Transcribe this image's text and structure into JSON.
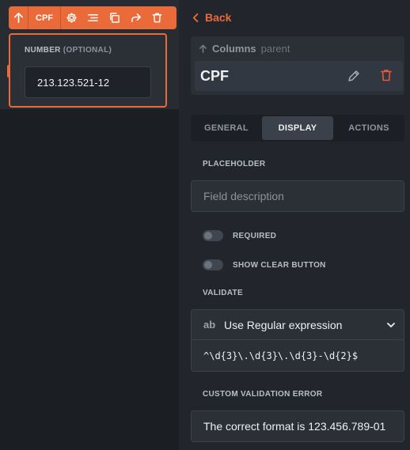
{
  "canvas": {
    "toolbar": {
      "label": "CPF",
      "icons": [
        "arrow-up-icon",
        "gear-icon",
        "align-icon",
        "copy-icon",
        "share-icon",
        "trash-icon"
      ]
    },
    "field": {
      "label": "NUMBER",
      "label_suffix": "(OPTIONAL)",
      "value": "213.123.521-12"
    }
  },
  "panel": {
    "back_label": "Back",
    "parent": {
      "name": "Columns",
      "suffix": "parent"
    },
    "element_title": "CPF",
    "tabs": [
      {
        "label": "GENERAL",
        "active": false
      },
      {
        "label": "DISPLAY",
        "active": true
      },
      {
        "label": "ACTIONS",
        "active": false
      }
    ],
    "placeholder": {
      "label": "PLACEHOLDER",
      "value": "Field description"
    },
    "required": {
      "label": "REQUIRED",
      "enabled": false
    },
    "show_clear": {
      "label": "SHOW CLEAR BUTTON",
      "enabled": false
    },
    "validate": {
      "label": "VALIDATE",
      "icon_text": "ab",
      "selected": "Use Regular expression",
      "expression": "^\\d{3}\\.\\d{3}\\.\\d{3}-\\d{2}$"
    },
    "custom_error": {
      "label": "CUSTOM VALIDATION ERROR",
      "value": "The correct format is 123.456.789-01"
    }
  },
  "colors": {
    "accent": "#ea6a3a",
    "background": "#1b1f24",
    "panel": "#22262c",
    "danger": "#e85a3a"
  }
}
